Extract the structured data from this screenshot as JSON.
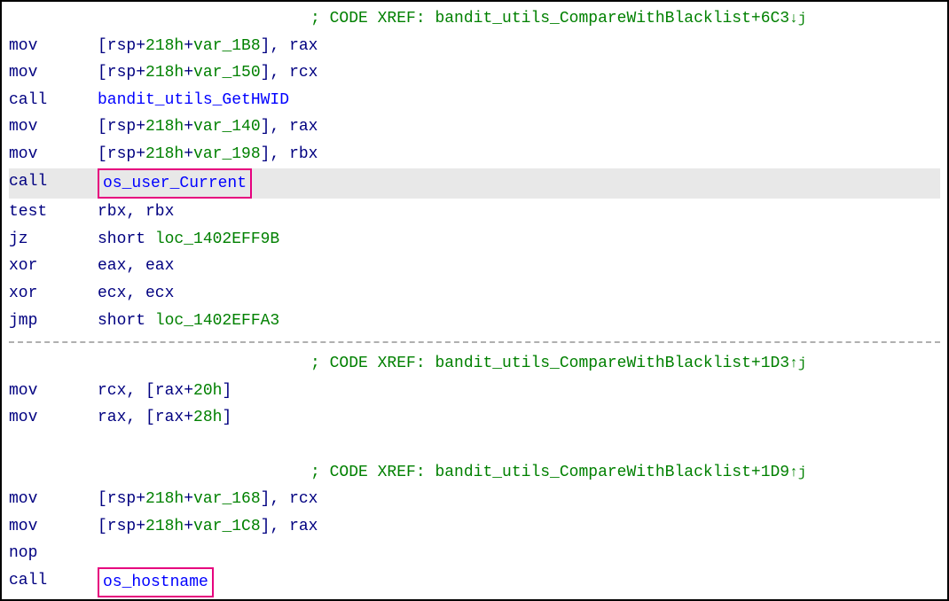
{
  "xref1_prefix": "; CODE XREF: ",
  "xref1_func": "bandit_utils_CompareWithBlacklist",
  "xref1_offset": "+6C3",
  "xref1_arrow": "↓j",
  "xref2_prefix": "; CODE XREF: ",
  "xref2_func": "bandit_utils_CompareWithBlacklist",
  "xref2_offset": "+1D3",
  "xref2_arrow": "↑j",
  "xref3_prefix": "; CODE XREF: ",
  "xref3_func": "bandit_utils_CompareWithBlacklist",
  "xref3_offset": "+1D9",
  "xref3_arrow": "↑j",
  "l1_mnem": "mov",
  "l1_op1": "[rsp+",
  "l1_c1": "218h",
  "l1_op2": "+",
  "l1_c2": "var_1B8",
  "l1_op3": "], rax",
  "l2_mnem": "mov",
  "l2_op1": "[rsp+",
  "l2_c1": "218h",
  "l2_op2": "+",
  "l2_c2": "var_150",
  "l2_op3": "], rcx",
  "l3_mnem": "call",
  "l3_func": "bandit_utils_GetHWID",
  "l4_mnem": "mov",
  "l4_op1": "[rsp+",
  "l4_c1": "218h",
  "l4_op2": "+",
  "l4_c2": "var_140",
  "l4_op3": "], rax",
  "l5_mnem": "mov",
  "l5_op1": "[rsp+",
  "l5_c1": "218h",
  "l5_op2": "+",
  "l5_c2": "var_198",
  "l5_op3": "], rbx",
  "l6_mnem": "call",
  "l6_func": "os_user_Current",
  "l7_mnem": "test",
  "l7_ops": "rbx, rbx",
  "l8_mnem": "jz",
  "l8_op1": "short ",
  "l8_c1": "loc_1402EFF9B",
  "l9_mnem": "xor",
  "l9_ops": "eax, eax",
  "l10_mnem": "xor",
  "l10_ops": "ecx, ecx",
  "l11_mnem": "jmp",
  "l11_op1": "short ",
  "l11_c1": "loc_1402EFFA3",
  "l12_mnem": "mov",
  "l12_op1": "rcx, [rax+",
  "l12_c1": "20h",
  "l12_op2": "]",
  "l13_mnem": "mov",
  "l13_op1": "rax, [rax+",
  "l13_c1": "28h",
  "l13_op2": "]",
  "l14_mnem": "mov",
  "l14_op1": "[rsp+",
  "l14_c1": "218h",
  "l14_op2": "+",
  "l14_c2": "var_168",
  "l14_op3": "], rcx",
  "l15_mnem": "mov",
  "l15_op1": "[rsp+",
  "l15_c1": "218h",
  "l15_op2": "+",
  "l15_c2": "var_1C8",
  "l15_op3": "], rax",
  "l16_mnem": "nop",
  "l17_mnem": "call",
  "l17_func": "os_hostname"
}
